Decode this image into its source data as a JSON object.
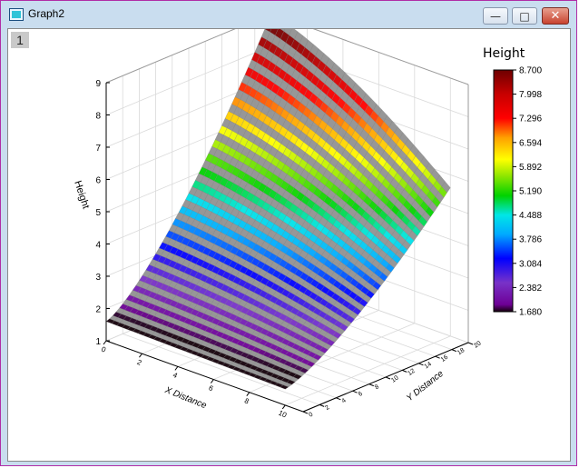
{
  "window": {
    "title": "Graph2",
    "layer_number": "1"
  },
  "controls": {
    "minimize": "minimize",
    "maximize": "maximize",
    "close": "close"
  },
  "chart_data": {
    "type": "surface",
    "xlabel": "X Distance",
    "ylabel": "Y Distance",
    "zlabel": "Height",
    "x_ticks": [
      "0",
      "2",
      "4",
      "6",
      "8",
      "10"
    ],
    "y_ticks": [
      "0",
      "2",
      "4",
      "6",
      "8",
      "10",
      "12",
      "14",
      "16",
      "18",
      "20"
    ],
    "z_ticks": [
      "1",
      "2",
      "3",
      "4",
      "5",
      "6",
      "7",
      "8",
      "9"
    ],
    "xlim": [
      0,
      11
    ],
    "ylim": [
      0,
      20
    ],
    "zlim": [
      1,
      9
    ],
    "colorbar": {
      "title": "Height",
      "levels": [
        "8.700",
        "7.998",
        "7.296",
        "6.594",
        "5.892",
        "5.190",
        "4.488",
        "3.786",
        "3.084",
        "2.382",
        "1.680"
      ],
      "min": 1.68,
      "max": 8.7
    },
    "surface_corners": {
      "x0_y0": 1.6,
      "x10_y0": 1.5,
      "x0_y20": 9.0,
      "x10_y20": 5.6
    }
  }
}
